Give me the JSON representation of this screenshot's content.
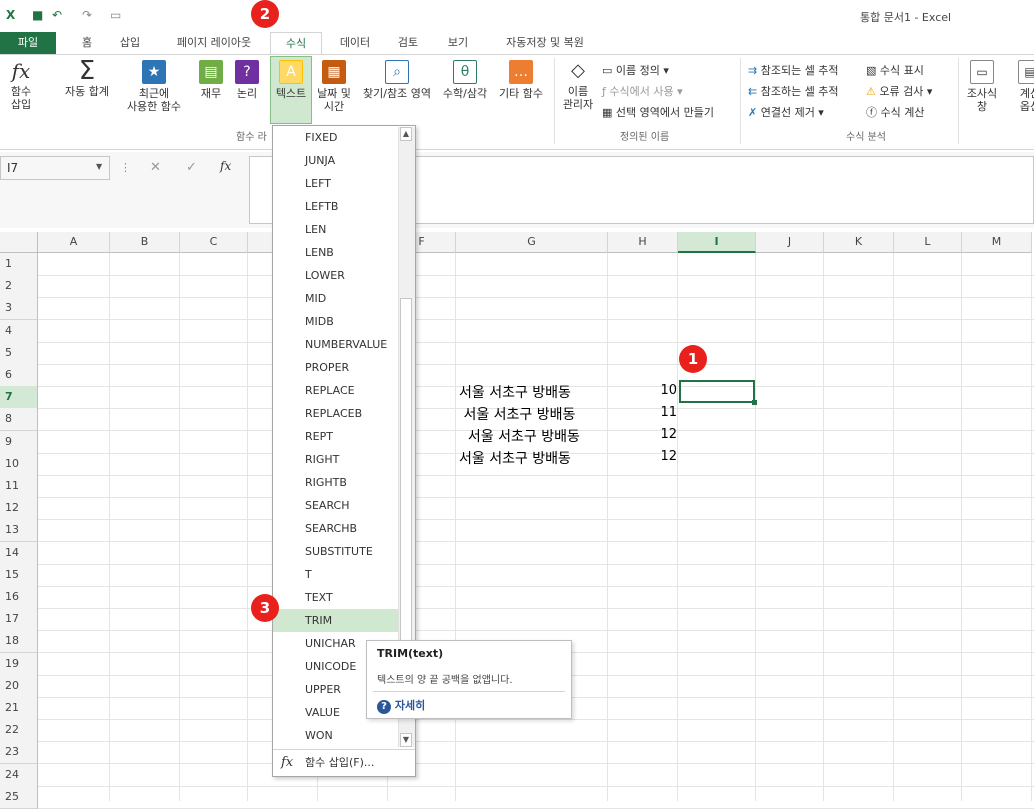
{
  "window": {
    "title": "통합 문서1 - Excel"
  },
  "quick_access": {
    "save_icon": "save-icon",
    "undo_icon": "undo-icon",
    "redo_icon": "redo-icon"
  },
  "tabs": [
    "파일",
    "홈",
    "삽입",
    "페이지 레이아웃",
    "수식",
    "데이터",
    "검토",
    "보기",
    "자동저장 및 복원"
  ],
  "ribbon": {
    "buttons": [
      {
        "label": "함수\n삽입",
        "icon": "fx"
      },
      {
        "label": "자동 합계",
        "icon": "Σ"
      },
      {
        "label": "최근에\n사용한 함수",
        "icon": "★"
      },
      {
        "label": "재무",
        "icon": "▤"
      },
      {
        "label": "논리",
        "icon": "?"
      },
      {
        "label": "텍스트",
        "icon": "A"
      },
      {
        "label": "날짜 및\n시간",
        "icon": "▦"
      },
      {
        "label": "찾기/참조 영역",
        "icon": "⌕"
      },
      {
        "label": "수학/삼각",
        "icon": "θ"
      },
      {
        "label": "기타 함수",
        "icon": "…"
      },
      {
        "label": "이름\n관리자",
        "icon": "◇"
      }
    ],
    "group_function_library": "함수 라",
    "defined_names": {
      "define_name": "이름 정의 ▾",
      "use_in_formula": "수식에서 사용 ▾",
      "create_from_selection": "선택 영역에서 만들기",
      "group_label": "정의된 이름"
    },
    "formula_auditing": {
      "trace_precedents": "참조되는 셀 추적",
      "trace_dependents": "참조하는 셀 추적",
      "remove_arrows": "연결선 제거 ▾",
      "show_formulas": "수식 표시",
      "error_checking": "오류 검사 ▾",
      "evaluate_formula": "수식 계산",
      "group_label": "수식 분석"
    },
    "watch_window": "조사식\n창",
    "calc_options": "계산\n옵션"
  },
  "formula_bar": {
    "name_box": "I7",
    "fx_label": "fx",
    "cancel": "✕",
    "enter": "✓",
    "value": ""
  },
  "columns": [
    "A",
    "B",
    "C",
    "D",
    "E",
    "F",
    "G",
    "H",
    "I",
    "J",
    "K",
    "L",
    "M"
  ],
  "rows": [
    "1",
    "2",
    "3",
    "4",
    "5",
    "6",
    "7",
    "8",
    "9",
    "10",
    "11",
    "12",
    "13",
    "14",
    "15",
    "16",
    "17",
    "18",
    "19",
    "20",
    "21",
    "22",
    "23",
    "24",
    "25"
  ],
  "cells": {
    "G7": "서울 서초구 방배동",
    "G8": " 서울 서초구 방배동",
    "G9": "  서울 서초구 방배동",
    "G10": "서울 서초구 방배동",
    "H7": "10",
    "H8": "11",
    "H9": "12",
    "H10": "12"
  },
  "active_cell": "I7",
  "dropdown": {
    "items": [
      "FIXED",
      "JUNJA",
      "LEFT",
      "LEFTB",
      "LEN",
      "LENB",
      "LOWER",
      "MID",
      "MIDB",
      "NUMBERVALUE",
      "PROPER",
      "REPLACE",
      "REPLACEB",
      "REPT",
      "RIGHT",
      "RIGHTB",
      "SEARCH",
      "SEARCHB",
      "SUBSTITUTE",
      "T",
      "TEXT",
      "TRIM",
      "UNICHAR",
      "UNICODE",
      "UPPER",
      "VALUE",
      "WON"
    ],
    "highlighted": "TRIM",
    "insert_function": "함수 삽입(F)..."
  },
  "tooltip": {
    "title": "TRIM(text)",
    "description": "텍스트의 양 끝 공백을 없앱니다.",
    "help_link": "자세히"
  },
  "badges": [
    "1",
    "2",
    "3"
  ],
  "colors": {
    "excel_green": "#217346",
    "badge_red": "#e8211d",
    "highlight": "#cfe8cf"
  }
}
